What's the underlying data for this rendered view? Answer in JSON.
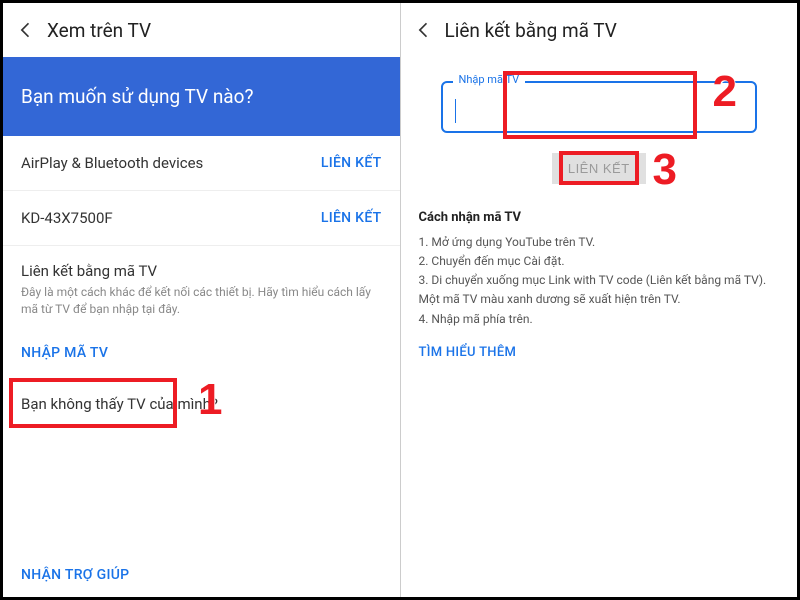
{
  "left": {
    "header_title": "Xem trên TV",
    "banner": "Bạn muốn sử dụng TV nào?",
    "devices": [
      {
        "name": "AirPlay & Bluetooth devices",
        "action": "LIÊN KẾT"
      },
      {
        "name": "KD-43X7500F",
        "action": "LIÊN KẾT"
      }
    ],
    "tvcode_title": "Liên kết bằng mã TV",
    "tvcode_desc": "Đây là một cách khác để kết nối các thiết bị. Hãy tìm hiểu cách lấy mã từ TV để bạn nhập tại đây.",
    "enter_code": "NHẬP MÃ TV",
    "not_see": "Bạn không thấy TV của mình?",
    "get_help": "NHẬN TRỢ GIÚP"
  },
  "right": {
    "header_title": "Liên kết bằng mã TV",
    "input_legend": "Nhập mã TV",
    "input_value": "",
    "link_btn": "LIÊN KẾT",
    "howto_title": "Cách nhận mã TV",
    "howto_steps": [
      "1. Mở ứng dụng YouTube trên TV.",
      "2. Chuyển đến mục Cài đặt.",
      "3. Di chuyển xuống mục Link with TV code (Liên kết bằng mã TV). Một mã TV màu xanh dương sẽ xuất hiện trên TV.",
      "4. Nhập mã phía trên."
    ],
    "learn_more": "TÌM HIỂU THÊM"
  },
  "annotations": {
    "n1": "1",
    "n2": "2",
    "n3": "3"
  }
}
